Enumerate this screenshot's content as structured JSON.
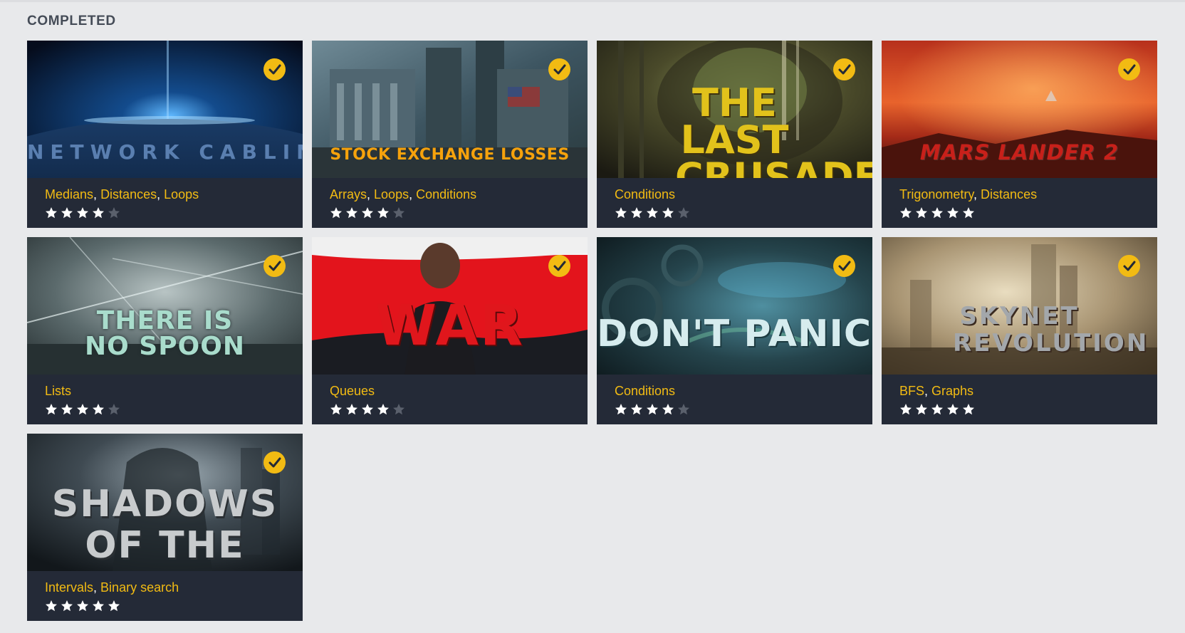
{
  "section": {
    "title": "COMPLETED"
  },
  "colors": {
    "accent": "#f2bb13",
    "card_bg": "#242a37",
    "page_bg": "#e8e9eb",
    "star_on": "#ffffff",
    "star_off": "#5a606c"
  },
  "icons": {
    "completed_badge": "check-circle-icon",
    "rating": "star-icon"
  },
  "puzzles": [
    {
      "cover_title": "NETWORK  CABLING",
      "tags": [
        "Medians",
        "Distances",
        "Loops"
      ],
      "rating": 4,
      "completed": true
    },
    {
      "cover_title": "STOCK EXCHANGE LOSSES",
      "tags": [
        "Arrays",
        "Loops",
        "Conditions"
      ],
      "rating": 4,
      "completed": true
    },
    {
      "cover_title": "THE LAST CRUSADE",
      "tags": [
        "Conditions"
      ],
      "rating": 4,
      "completed": true
    },
    {
      "cover_title": "MARS LANDER 2",
      "tags": [
        "Trigonometry",
        "Distances"
      ],
      "rating": 5,
      "completed": true
    },
    {
      "cover_title": "THERE IS NO SPOON",
      "tags": [
        "Lists"
      ],
      "rating": 4,
      "completed": true
    },
    {
      "cover_title": "WAR",
      "tags": [
        "Queues"
      ],
      "rating": 4,
      "completed": true
    },
    {
      "cover_title": "DON'T PANIC!",
      "tags": [
        "Conditions"
      ],
      "rating": 4,
      "completed": true
    },
    {
      "cover_title": "SKYNET REVOLUTION",
      "tags": [
        "BFS",
        "Graphs"
      ],
      "rating": 5,
      "completed": true
    },
    {
      "cover_title": "SHADOWS OF THE KNIGHT",
      "tags": [
        "Intervals",
        "Binary search"
      ],
      "rating": 5,
      "completed": true
    }
  ]
}
